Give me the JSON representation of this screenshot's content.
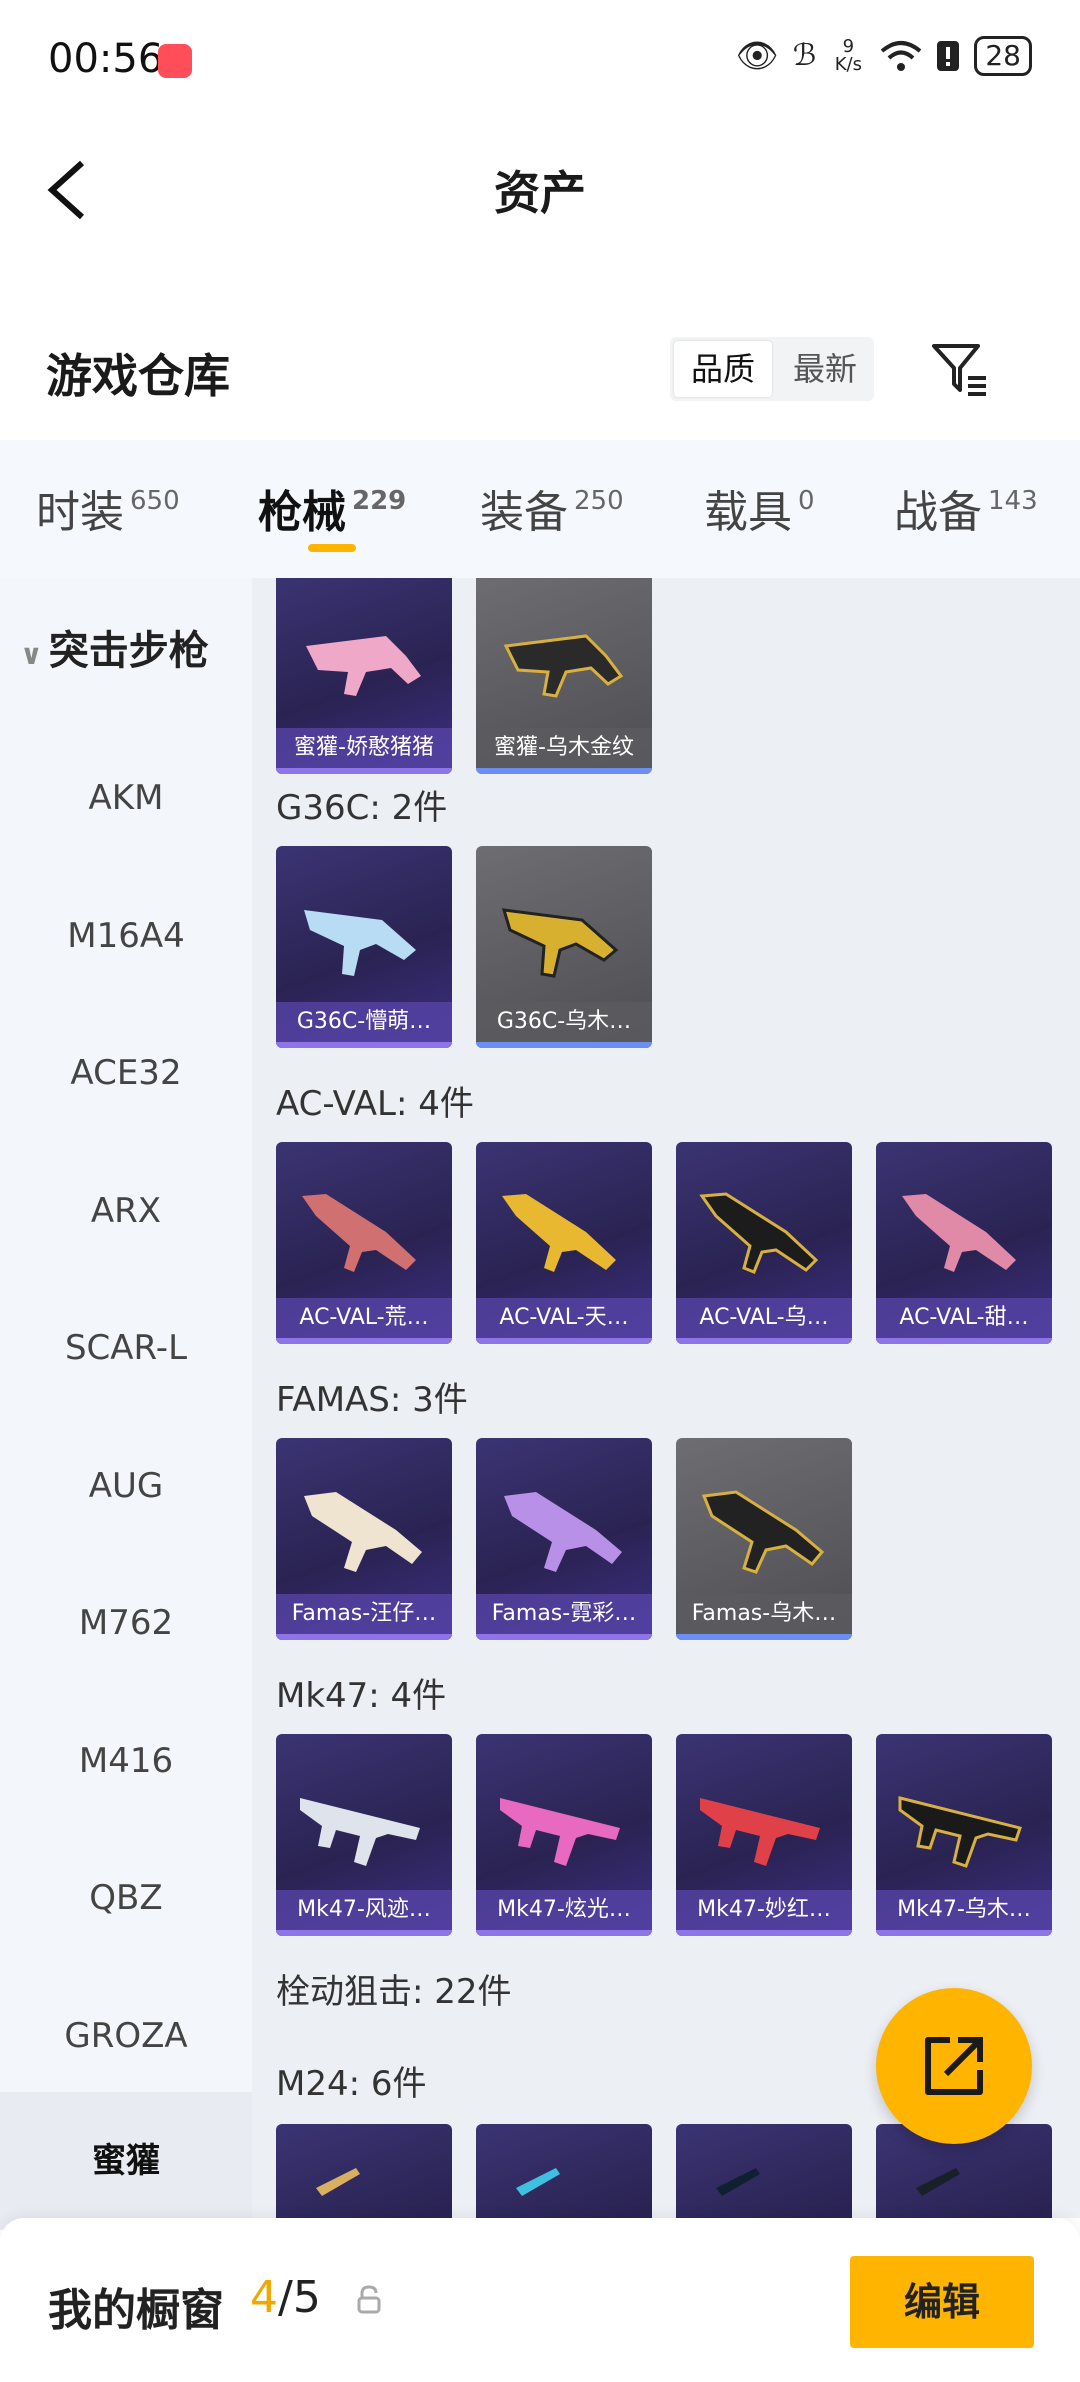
{
  "status_bar": {
    "time": "00:56",
    "net_speed_value": "9",
    "net_speed_unit": "K/s",
    "battery": "28"
  },
  "header": {
    "title": "资产"
  },
  "warehouse": {
    "title": "游戏仓库",
    "sort_options": [
      "品质",
      "最新"
    ],
    "active_sort": "品质"
  },
  "tabs": [
    {
      "label": "时装",
      "count": "650"
    },
    {
      "label": "枪械",
      "count": "229"
    },
    {
      "label": "装备",
      "count": "250"
    },
    {
      "label": "载具",
      "count": "0"
    },
    {
      "label": "战备",
      "count": "143"
    }
  ],
  "active_tab": "枪械",
  "sidebar": {
    "category": "突击步枪",
    "items": [
      "AKM",
      "M16A4",
      "ACE32",
      "ARX",
      "SCAR-L",
      "AUG",
      "M762",
      "M416",
      "QBZ",
      "GROZA",
      "蜜獾"
    ],
    "selected": "蜜獾"
  },
  "groups": [
    {
      "label": "",
      "items": [
        "蜜獾-娇憨猪猪",
        "蜜獾-乌木金纹"
      ]
    },
    {
      "label": "G36C: 2件",
      "items": [
        "G36C-懵萌…",
        "G36C-乌木…"
      ]
    },
    {
      "label": "AC-VAL: 4件",
      "items": [
        "AC-VAL-荒…",
        "AC-VAL-天…",
        "AC-VAL-乌…",
        "AC-VAL-甜…"
      ]
    },
    {
      "label": "FAMAS: 3件",
      "items": [
        "Famas-汪仔…",
        "Famas-霓彩…",
        "Famas-乌木…"
      ]
    },
    {
      "label": "Mk47: 4件",
      "items": [
        "Mk47-风迹…",
        "Mk47-炫光…",
        "Mk47-妙红…",
        "Mk47-乌木…"
      ]
    },
    {
      "label": "栓动狙击: 22件",
      "items": []
    },
    {
      "label": "M24: 6件",
      "items": [
        "",
        "",
        "",
        ""
      ]
    }
  ],
  "bottom_bar": {
    "title": "我的橱窗",
    "current": "4",
    "total": "/5",
    "edit_label": "编辑"
  }
}
